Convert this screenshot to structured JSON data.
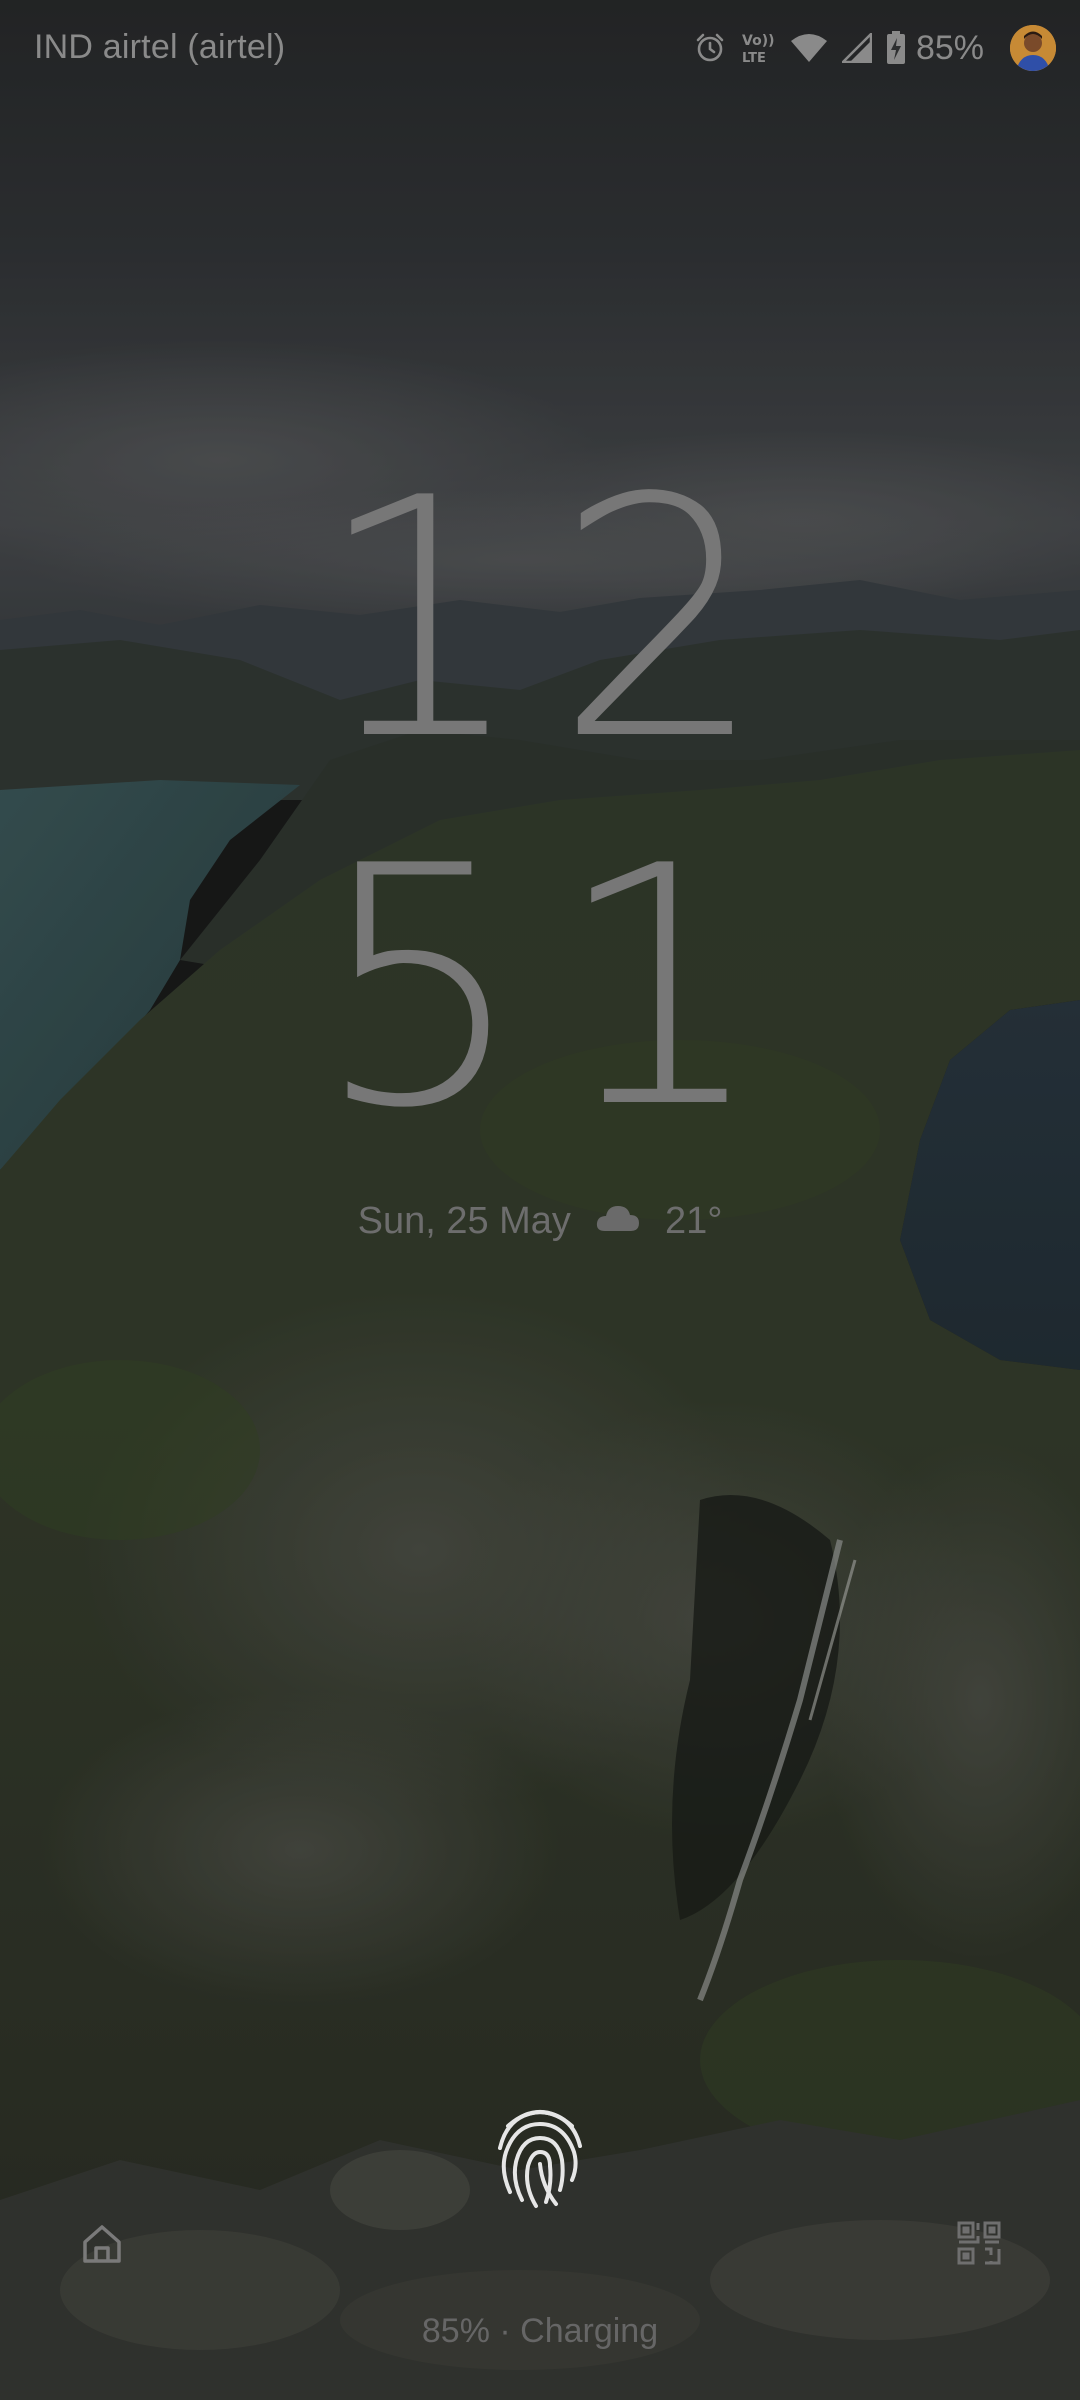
{
  "status_bar": {
    "carrier": "IND airtel (airtel)",
    "battery_percent": "85%",
    "icons": [
      "alarm-icon",
      "volte-icon",
      "wifi-icon",
      "signal-icon",
      "battery-charging-icon"
    ],
    "volte_top": "Vo))",
    "volte_bottom": "LTE"
  },
  "clock": {
    "hours": "12",
    "minutes": "51"
  },
  "date_weather": {
    "date": "Sun, 25 May",
    "temperature": "21°",
    "weather_icon": "cloud-icon"
  },
  "bottom": {
    "charging_status": "85% · Charging",
    "left_shortcut_icon": "home-icon",
    "right_shortcut_icon": "qr-code-icon",
    "unlock_icon": "fingerprint-icon"
  },
  "colors": {
    "text_primary": "#777777",
    "text_secondary": "#6d6d6d"
  }
}
